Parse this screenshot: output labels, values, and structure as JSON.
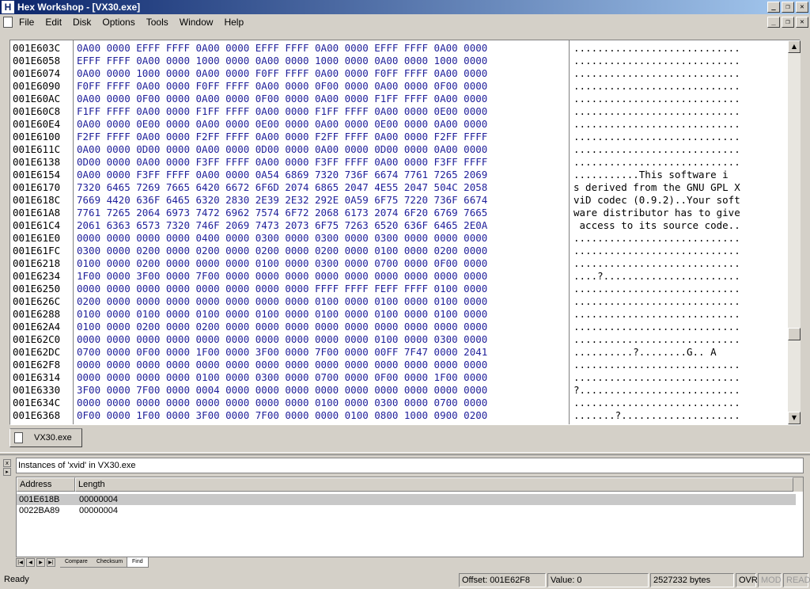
{
  "window": {
    "title": "Hex Workshop - [VX30.exe]"
  },
  "menu": [
    "File",
    "Edit",
    "Disk",
    "Options",
    "Tools",
    "Window",
    "Help"
  ],
  "hex_view": {
    "offsets": [
      "001E603C",
      "001E6058",
      "001E6074",
      "001E6090",
      "001E60AC",
      "001E60C8",
      "001E60E4",
      "001E6100",
      "001E611C",
      "001E6138",
      "001E6154",
      "001E6170",
      "001E618C",
      "001E61A8",
      "001E61C4",
      "001E61E0",
      "001E61FC",
      "001E6218",
      "001E6234",
      "001E6250",
      "001E626C",
      "001E6288",
      "001E62A4",
      "001E62C0",
      "001E62DC",
      "001E62F8",
      "001E6314",
      "001E6330",
      "001E634C",
      "001E6368"
    ],
    "hex": [
      "0A00 0000 EFFF FFFF 0A00 0000 EFFF FFFF 0A00 0000 EFFF FFFF 0A00 0000",
      "EFFF FFFF 0A00 0000 1000 0000 0A00 0000 1000 0000 0A00 0000 1000 0000",
      "0A00 0000 1000 0000 0A00 0000 F0FF FFFF 0A00 0000 F0FF FFFF 0A00 0000",
      "F0FF FFFF 0A00 0000 F0FF FFFF 0A00 0000 0F00 0000 0A00 0000 0F00 0000",
      "0A00 0000 0F00 0000 0A00 0000 0F00 0000 0A00 0000 F1FF FFFF 0A00 0000",
      "F1FF FFFF 0A00 0000 F1FF FFFF 0A00 0000 F1FF FFFF 0A00 0000 0E00 0000",
      "0A00 0000 0E00 0000 0A00 0000 0E00 0000 0A00 0000 0E00 0000 0A00 0000",
      "F2FF FFFF 0A00 0000 F2FF FFFF 0A00 0000 F2FF FFFF 0A00 0000 F2FF FFFF",
      "0A00 0000 0D00 0000 0A00 0000 0D00 0000 0A00 0000 0D00 0000 0A00 0000",
      "0D00 0000 0A00 0000 F3FF FFFF 0A00 0000 F3FF FFFF 0A00 0000 F3FF FFFF",
      "0A00 0000 F3FF FFFF 0A00 0000 0A54 6869 7320 736F 6674 7761 7265 2069",
      "7320 6465 7269 7665 6420 6672 6F6D 2074 6865 2047 4E55 2047 504C 2058",
      "7669 4420 636F 6465 6320 2830 2E39 2E32 292E 0A59 6F75 7220 736F 6674",
      "7761 7265 2064 6973 7472 6962 7574 6F72 2068 6173 2074 6F20 6769 7665",
      "2061 6363 6573 7320 746F 2069 7473 2073 6F75 7263 6520 636F 6465 2E0A",
      "0000 0000 0000 0000 0400 0000 0300 0000 0300 0000 0300 0000 0000 0000",
      "0300 0000 0200 0000 0200 0000 0200 0000 0200 0000 0100 0000 0200 0000",
      "0100 0000 0200 0000 0000 0000 0100 0000 0300 0000 0700 0000 0F00 0000",
      "1F00 0000 3F00 0000 7F00 0000 0000 0000 0000 0000 0000 0000 0000 0000",
      "0000 0000 0000 0000 0000 0000 0000 0000 FFFF FFFF FEFF FFFF 0100 0000",
      "0200 0000 0000 0000 0000 0000 0000 0000 0100 0000 0100 0000 0100 0000",
      "0100 0000 0100 0000 0100 0000 0100 0000 0100 0000 0100 0000 0100 0000",
      "0100 0000 0200 0000 0200 0000 0000 0000 0000 0000 0000 0000 0000 0000",
      "0000 0000 0000 0000 0000 0000 0000 0000 0000 0000 0100 0000 0300 0000",
      "0700 0000 0F00 0000 1F00 0000 3F00 0000 7F00 0000 00FF 7F47 0000 2041",
      "0000 0000 0000 0000 0000 0000 0000 0000 0000 0000 0000 0000 0000 0000",
      "0000 0000 0000 0000 0100 0000 0300 0000 0700 0000 0F00 0000 1F00 0000",
      "3F00 0000 7F00 0000 0004 0000 0000 0000 0000 0000 0000 0000 0000 0000",
      "0000 0000 0000 0000 0000 0000 0000 0000 0100 0000 0300 0000 0700 0000",
      "0F00 0000 1F00 0000 3F00 0000 7F00 0000 0000 0100 0800 1000 0900 0200"
    ],
    "ascii": [
      "............................",
      "............................",
      "............................",
      "............................",
      "............................",
      "............................",
      "............................",
      "............................",
      "............................",
      "............................",
      "...........This software i",
      "s derived from the GNU GPL X",
      "viD codec (0.9.2)..Your soft",
      "ware distributor has to give",
      " access to its source code..",
      "............................",
      "............................",
      "............................",
      "....?.......................",
      "............................",
      "............................",
      "............................",
      "............................",
      "............................",
      "..........?........G.. A",
      "............................",
      "............................",
      "?...........................",
      "............................",
      ".......?...................."
    ]
  },
  "file_tab": {
    "label": "VX30.exe"
  },
  "results": {
    "title": "Instances of 'xvid' in VX30.exe",
    "columns": [
      "Address",
      "Length"
    ],
    "rows": [
      {
        "address": "001E618B",
        "length": "00000004"
      },
      {
        "address": "0022BA89",
        "length": "00000004"
      }
    ],
    "tabs": [
      "Compare",
      "Checksum",
      "Find"
    ]
  },
  "status": {
    "ready": "Ready",
    "offset": "Offset: 001E62F8",
    "value": "Value: 0",
    "size": "2527232 bytes",
    "ovr": "OVR",
    "mod": "MOD",
    "read": "READ"
  }
}
